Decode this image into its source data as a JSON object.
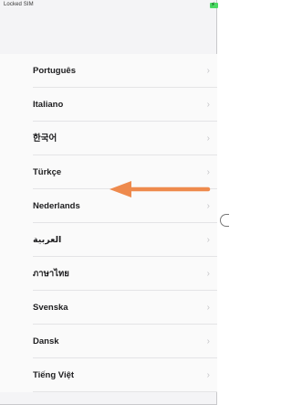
{
  "status_bar": {
    "carrier": "Locked SIM",
    "battery_icon": "battery-charging-icon",
    "battery_color": "#4cd964"
  },
  "languages": [
    {
      "label": "Português"
    },
    {
      "label": "Italiano"
    },
    {
      "label": "한국어"
    },
    {
      "label": "Türkçe"
    },
    {
      "label": "Nederlands"
    },
    {
      "label": "العربية"
    },
    {
      "label": "ภาษาไทย"
    },
    {
      "label": "Svenska"
    },
    {
      "label": "Dansk"
    },
    {
      "label": "Tiếng Việt"
    }
  ],
  "chevron": "›",
  "annotation": {
    "icon": "left-arrow-icon",
    "color": "#ee8a4d",
    "points_to": "Nederlands"
  }
}
